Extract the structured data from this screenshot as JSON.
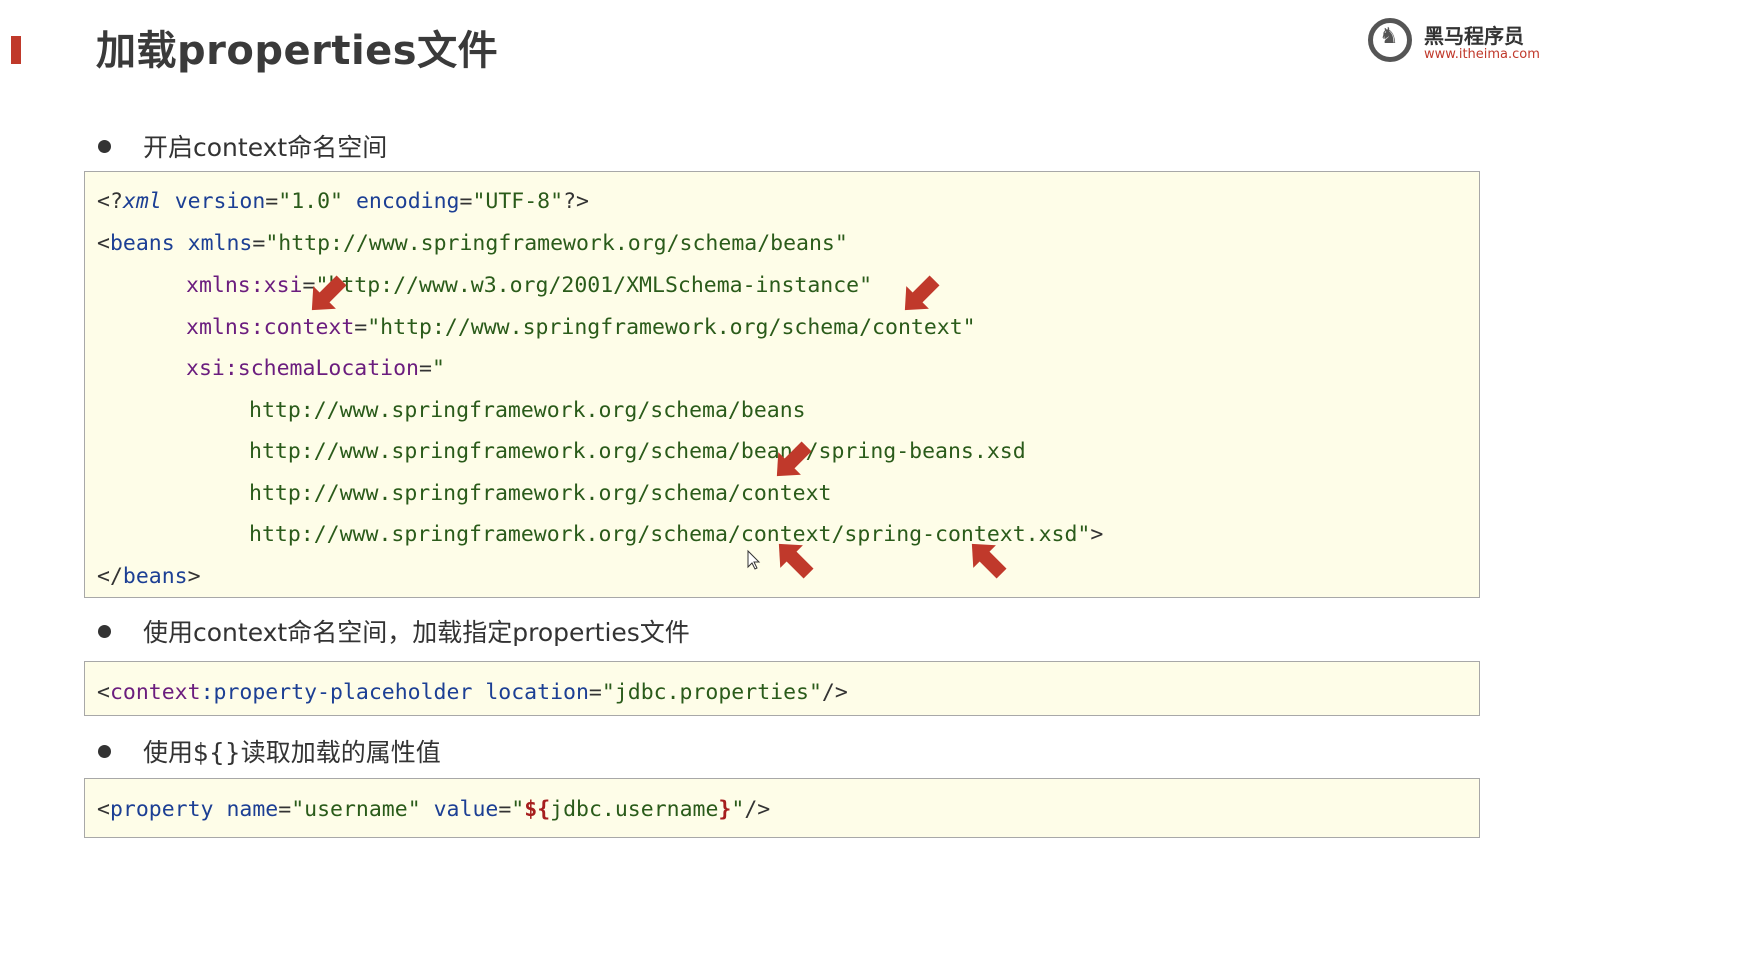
{
  "slide": {
    "title": "加载properties文件",
    "accent_color": "#c0392b"
  },
  "logo": {
    "name": "黑马程序员",
    "url": "www.itheima.com"
  },
  "bullets": [
    "开启context命名空间",
    "使用context命名空间，加载指定properties文件",
    "使用${}读取加载的属性值"
  ],
  "code1": {
    "decl_open": "<?",
    "decl_name": "xml",
    "decl_version_attr": "version",
    "decl_version_val": "\"1.0\"",
    "decl_encoding_attr": "encoding",
    "decl_encoding_val": "\"UTF-8\"",
    "decl_close": "?>",
    "beans_open": "<",
    "beans_tag": "beans",
    "xmlns_attr": "xmlns",
    "xmlns_val": "\"http://www.springframework.org/schema/beans\"",
    "xsi_attr": "xmlns:xsi",
    "xsi_val": "\"http://www.w3.org/2001/XMLSchema-instance\"",
    "ctx_prefix": "xmlns:",
    "ctx_name": "context",
    "ctx_val": "\"http://www.springframework.org/schema/context\"",
    "schema_attr": "xsi:schemaLocation",
    "schema_quote": "\"",
    "schema_lines": [
      "http://www.springframework.org/schema/beans",
      "http://www.springframework.org/schema/beans/spring-beans.xsd",
      "http://www.springframework.org/schema/context",
      "http://www.springframework.org/schema/context/spring-context.xsd\""
    ],
    "end_bracket": ">",
    "beans_close_open": "</",
    "beans_close_tag": "beans",
    "beans_close_end": ">"
  },
  "code2": {
    "open": "<",
    "ns": "context",
    "tag": ":property-placeholder",
    "attr": "location",
    "val": "\"jdbc.properties\"",
    "close": "/>"
  },
  "code3": {
    "open": "<",
    "tag": "property",
    "name_attr": "name",
    "name_val": "\"username\"",
    "value_attr": "value",
    "q1": "\"",
    "var_open": "${",
    "var_name": "jdbc.username",
    "var_close": "}",
    "q2": "\"",
    "close": "/>"
  },
  "arrow_color": "#c0392b"
}
